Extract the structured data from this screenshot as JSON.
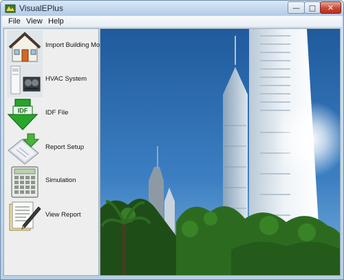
{
  "window": {
    "title": "VisualEPlus",
    "controls": {
      "minimize": "—",
      "maximize": "□",
      "close": "✕"
    }
  },
  "menu": {
    "file": "File",
    "view": "View",
    "help": "Help"
  },
  "sidebar": {
    "items": [
      {
        "label": "Import Building Model",
        "icon": "house-icon"
      },
      {
        "label": "HVAC System",
        "icon": "hvac-units-icon"
      },
      {
        "label": "IDF File",
        "icon": "idf-download-arrow-icon"
      },
      {
        "label": "Report Setup",
        "icon": "report-setup-icon"
      },
      {
        "label": "Simulation",
        "icon": "calculator-icon"
      },
      {
        "label": "View Report",
        "icon": "report-pen-icon"
      }
    ]
  },
  "main": {
    "image": "photo of skyscrapers with palm trees under blue sky"
  },
  "idf_icon_text": "IDF"
}
